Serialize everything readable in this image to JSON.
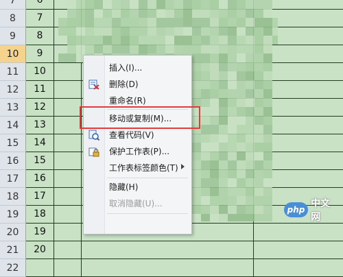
{
  "rows": [
    {
      "num": "7",
      "a": "6"
    },
    {
      "num": "8",
      "a": "7"
    },
    {
      "num": "9",
      "a": "8"
    },
    {
      "num": "10",
      "a": "9"
    },
    {
      "num": "11",
      "a": "10"
    },
    {
      "num": "12",
      "a": "11"
    },
    {
      "num": "13",
      "a": "12"
    },
    {
      "num": "14",
      "a": "13"
    },
    {
      "num": "15",
      "a": "14"
    },
    {
      "num": "16",
      "a": "15"
    },
    {
      "num": "17",
      "a": "16"
    },
    {
      "num": "18",
      "a": "17"
    },
    {
      "num": "19",
      "a": "18"
    },
    {
      "num": "20",
      "a": "19"
    },
    {
      "num": "21",
      "a": "20"
    },
    {
      "num": "22",
      "a": ""
    }
  ],
  "selected_row": "10",
  "context_menu": {
    "items": [
      {
        "label": "插入(I)...",
        "icon": "",
        "disabled": false,
        "submenu": false
      },
      {
        "label": "删除(D)",
        "icon": "delete-icon",
        "disabled": false,
        "submenu": false
      },
      {
        "label": "重命名(R)",
        "icon": "",
        "disabled": false,
        "submenu": false
      },
      {
        "label": "移动或复制(M)...",
        "icon": "",
        "disabled": false,
        "submenu": false
      },
      {
        "label": "查看代码(V)",
        "icon": "view-code-icon",
        "disabled": false,
        "submenu": false
      },
      {
        "label": "保护工作表(P)...",
        "icon": "protect-sheet-icon",
        "disabled": false,
        "submenu": false
      },
      {
        "label": "工作表标签颜色(T)",
        "icon": "",
        "disabled": false,
        "submenu": true
      },
      {
        "label": "隐藏(H)",
        "icon": "",
        "disabled": false,
        "submenu": false
      },
      {
        "label": "取消隐藏(U)...",
        "icon": "",
        "disabled": true,
        "submenu": false
      }
    ]
  },
  "watermark": {
    "logo": "php",
    "text": "中文网"
  },
  "colors": {
    "highlight": "#e23a3a",
    "sheet": "#c9e2c6",
    "selected_header": "#f6d38c"
  }
}
